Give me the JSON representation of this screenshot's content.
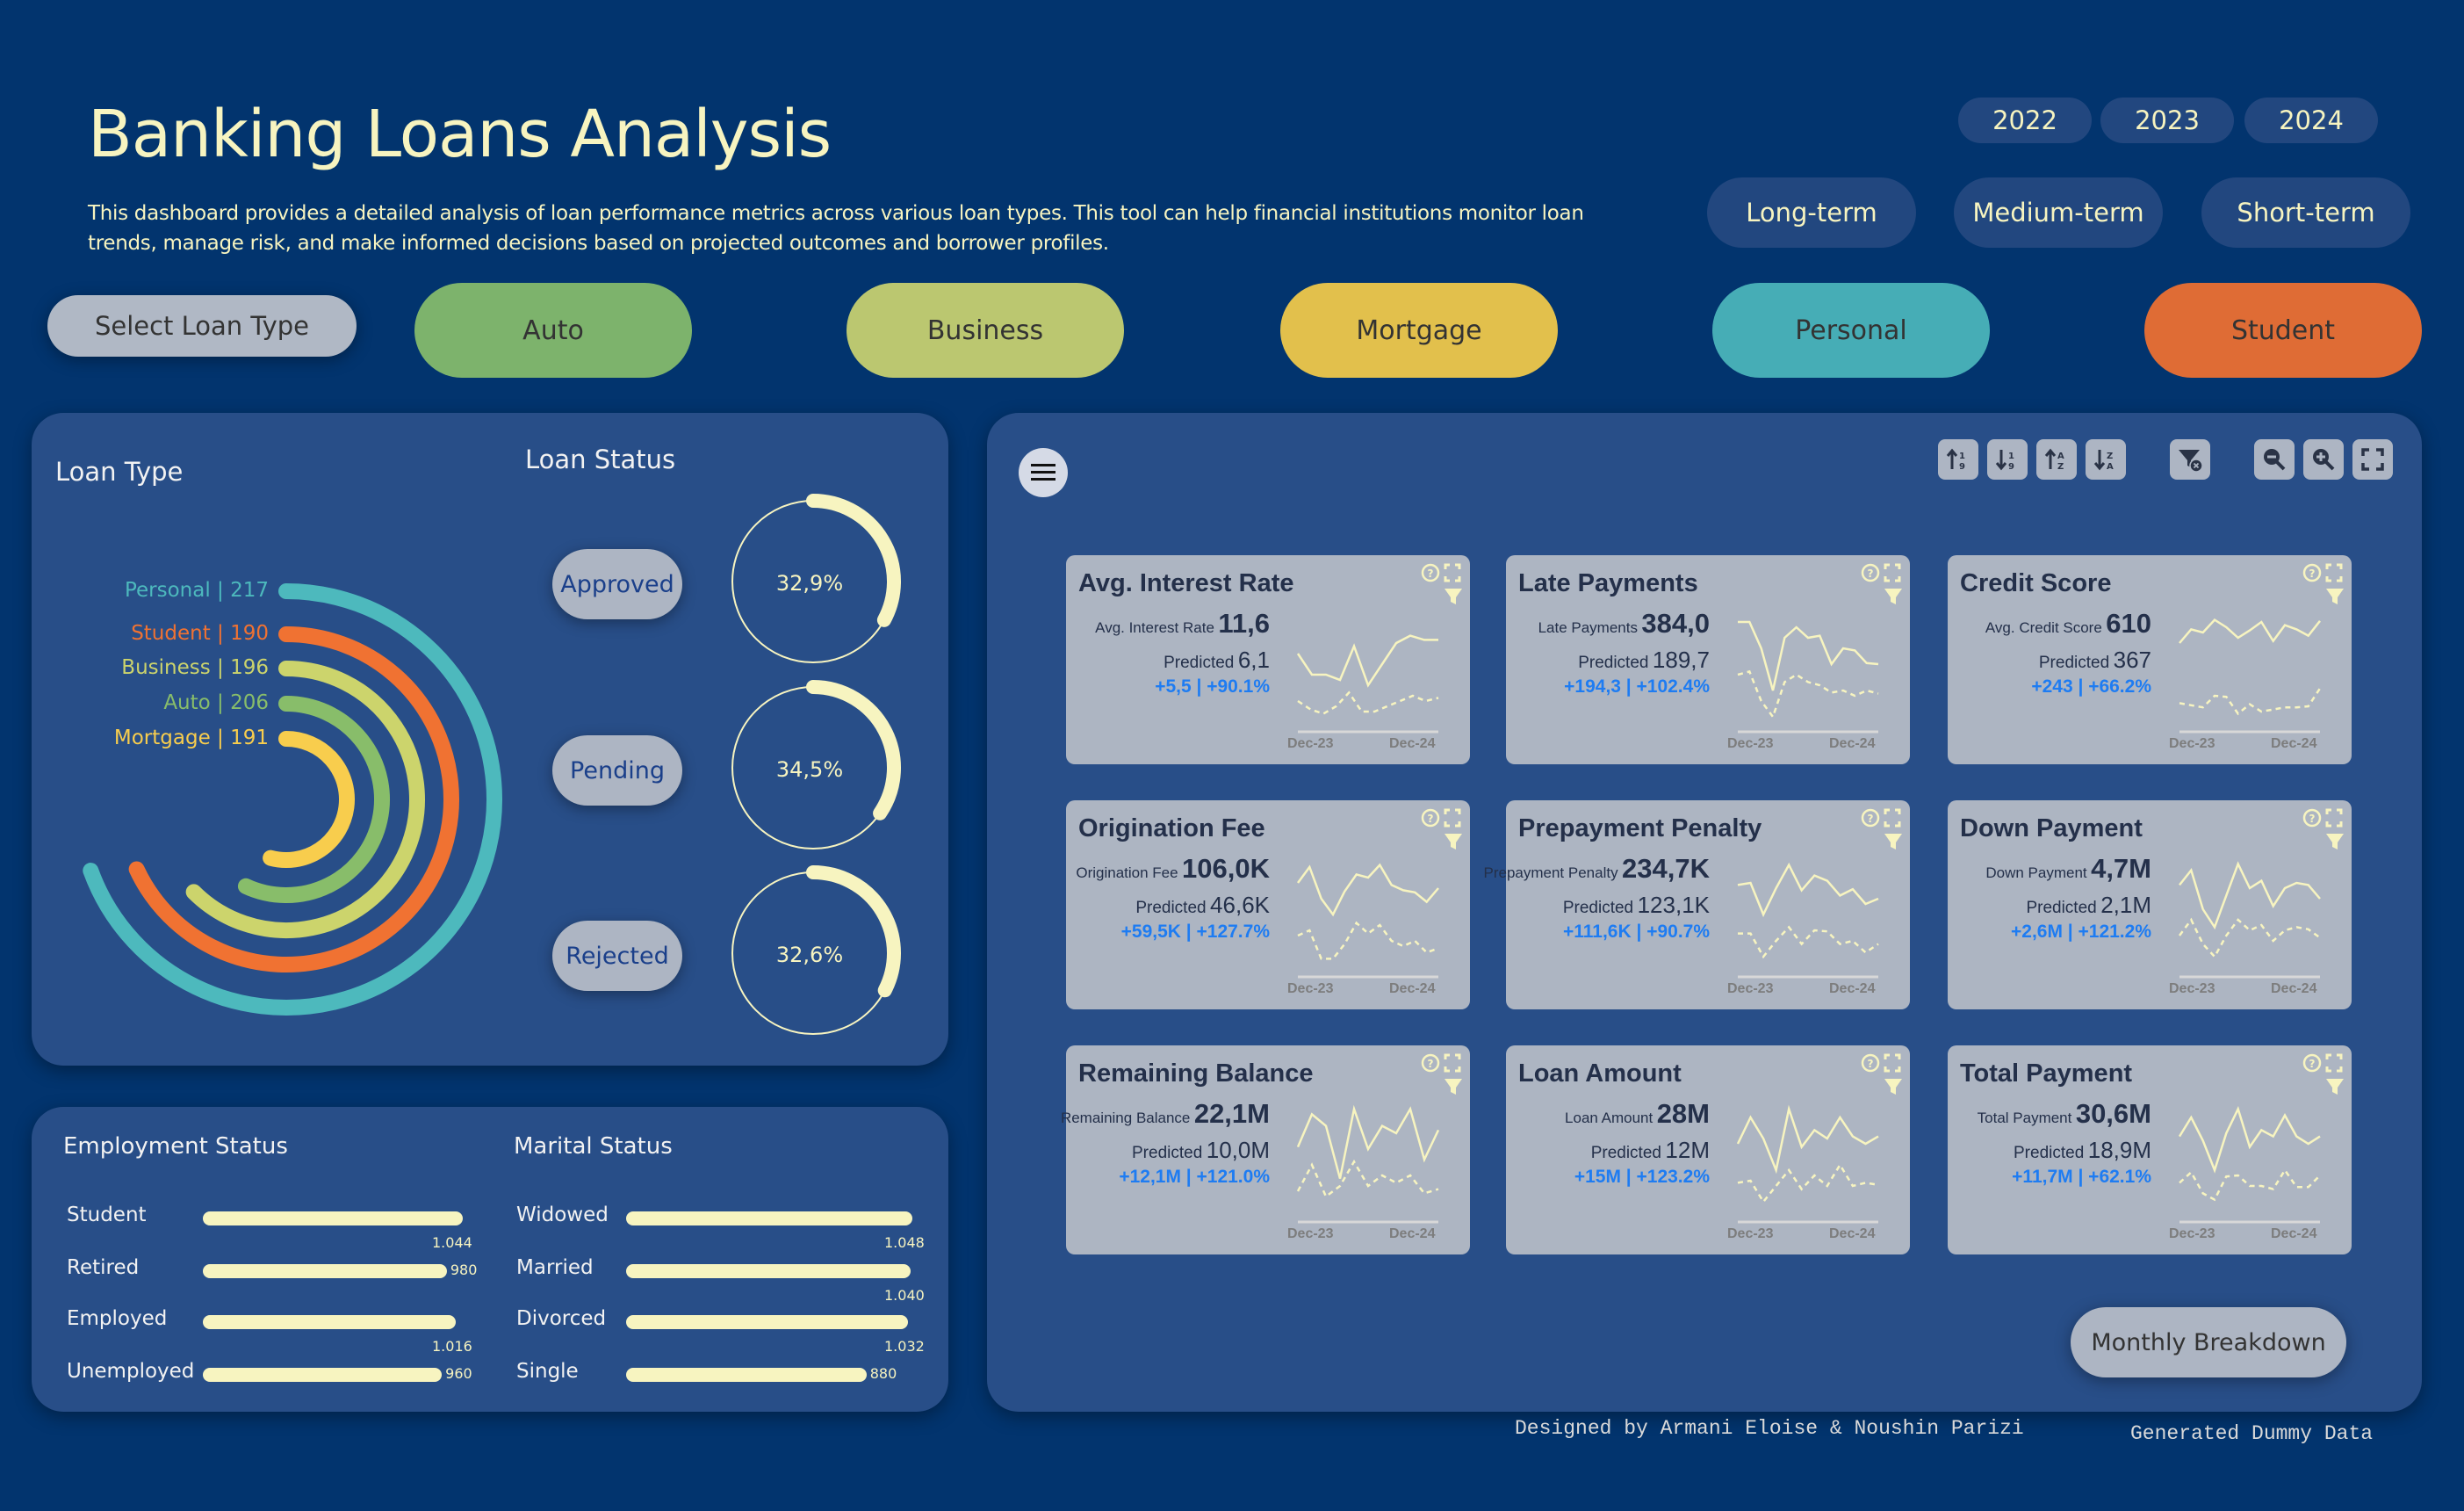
{
  "header": {
    "title": "Banking Loans Analysis",
    "description": "This dashboard provides a detailed analysis of loan performance metrics across various loan types. This tool can help financial institutions monitor loan trends, manage risk, and make informed decisions based on projected outcomes and borrower profiles."
  },
  "years": [
    "2022",
    "2023",
    "2024"
  ],
  "terms": [
    "Long-term",
    "Medium-term",
    "Short-term"
  ],
  "loan_type_filter": {
    "label": "Select Loan Type",
    "types": [
      {
        "label": "Auto",
        "color": "#7db36c"
      },
      {
        "label": "Business",
        "color": "#bbc770"
      },
      {
        "label": "Mortgage",
        "color": "#e2c04c"
      },
      {
        "label": "Personal",
        "color": "#46adb6"
      },
      {
        "label": "Student",
        "color": "#df6c35"
      }
    ]
  },
  "loan_type_panel": {
    "title": "Loan Type",
    "items": [
      {
        "label": "Personal",
        "count": "217",
        "text": "Personal | 217",
        "color": "#4db9bd"
      },
      {
        "label": "Student",
        "count": "190",
        "text": "Student | 190",
        "color": "#f07232"
      },
      {
        "label": "Business",
        "count": "196",
        "text": "Business | 196",
        "color": "#ccd46c"
      },
      {
        "label": "Auto",
        "count": "206",
        "text": "Auto | 206",
        "color": "#88bd6a"
      },
      {
        "label": "Mortgage",
        "count": "191",
        "text": "Mortgage | 191",
        "color": "#f8cd4d"
      }
    ]
  },
  "loan_status_panel": {
    "title": "Loan Status",
    "items": [
      {
        "label": "Approved",
        "percent_text": "32,9%",
        "percent": 32.9
      },
      {
        "label": "Pending",
        "percent_text": "34,5%",
        "percent": 34.5
      },
      {
        "label": "Rejected",
        "percent_text": "32,6%",
        "percent": 32.6
      }
    ]
  },
  "employment_status": {
    "title": "Employment Status",
    "items": [
      {
        "label": "Student",
        "value": 1044,
        "value_text": "1.044"
      },
      {
        "label": "Retired",
        "value": 980,
        "value_text": "980"
      },
      {
        "label": "Employed",
        "value": 1016,
        "value_text": "1.016"
      },
      {
        "label": "Unemployed",
        "value": 960,
        "value_text": "960"
      }
    ]
  },
  "marital_status": {
    "title": "Marital Status",
    "items": [
      {
        "label": "Widowed",
        "value": 1048,
        "value_text": "1.048"
      },
      {
        "label": "Married",
        "value": 1040,
        "value_text": "1.040"
      },
      {
        "label": "Divorced",
        "value": 1032,
        "value_text": "1.032"
      },
      {
        "label": "Single",
        "value": 880,
        "value_text": "880"
      }
    ]
  },
  "toolbar": {
    "menu": "menu-icon",
    "buttons": [
      "sort-ascending-numeric-icon",
      "sort-descending-numeric-icon",
      "sort-ascending-alpha-icon",
      "sort-descending-alpha-icon",
      "clear-filter-icon",
      "zoom-out-icon",
      "zoom-in-icon",
      "fullscreen-icon"
    ]
  },
  "kpi_cards": [
    {
      "title": "Avg. Interest Rate",
      "metric_label": "Avg. Interest Rate",
      "value": "11,6",
      "predicted_label": "Predicted",
      "predicted": "6,1",
      "delta": "+5,5 | +90.1%",
      "actual": [
        0.65,
        0.45,
        0.45,
        0.4,
        0.72,
        0.35,
        0.55,
        0.75,
        0.82,
        0.78,
        0.78
      ],
      "forecast": [
        0.2,
        0.12,
        0.08,
        0.15,
        0.28,
        0.1,
        0.1,
        0.15,
        0.2,
        0.25,
        0.2,
        0.23
      ]
    },
    {
      "title": "Late Payments",
      "metric_label": "Late Payments",
      "value": "384,0",
      "predicted_label": "Predicted",
      "predicted": "189,7",
      "delta": "+194,3 | +102.4%",
      "actual": [
        0.95,
        0.95,
        0.7,
        0.3,
        0.8,
        0.9,
        0.8,
        0.82,
        0.55,
        0.7,
        0.68,
        0.56,
        0.55
      ],
      "forecast": [
        0.45,
        0.48,
        0.2,
        0.05,
        0.38,
        0.45,
        0.38,
        0.35,
        0.28,
        0.3,
        0.25,
        0.3,
        0.27
      ]
    },
    {
      "title": "Credit Score",
      "metric_label": "Avg. Credit Score",
      "value": "610",
      "predicted_label": "Predicted",
      "predicted": "367",
      "delta": "+243 | +66.2%",
      "actual": [
        0.75,
        0.88,
        0.85,
        0.97,
        0.9,
        0.8,
        0.87,
        0.95,
        0.77,
        0.92,
        0.88,
        0.82,
        0.96
      ],
      "forecast": [
        0.18,
        0.16,
        0.14,
        0.25,
        0.24,
        0.08,
        0.17,
        0.1,
        0.12,
        0.14,
        0.14,
        0.15,
        0.32
      ]
    },
    {
      "title": "Origination Fee",
      "metric_label": "Origination Fee",
      "value": "106,0K",
      "predicted_label": "Predicted",
      "predicted": "46,6K",
      "delta": "+59,5K | +127.7%",
      "actual": [
        0.8,
        0.95,
        0.65,
        0.5,
        0.72,
        0.88,
        0.85,
        0.97,
        0.78,
        0.73,
        0.71,
        0.62,
        0.75
      ],
      "forecast": [
        0.3,
        0.35,
        0.08,
        0.08,
        0.22,
        0.42,
        0.32,
        0.4,
        0.25,
        0.2,
        0.25,
        0.14,
        0.18
      ]
    },
    {
      "title": "Prepayment Penalty",
      "metric_label": "Prepayment Penalty",
      "value": "234,7K",
      "predicted_label": "Predicted",
      "predicted": "123,1K",
      "delta": "+111,6K | +90.7%",
      "actual": [
        0.78,
        0.8,
        0.5,
        0.75,
        0.97,
        0.73,
        0.87,
        0.82,
        0.68,
        0.74,
        0.6,
        0.65
      ],
      "forecast": [
        0.32,
        0.32,
        0.1,
        0.25,
        0.38,
        0.22,
        0.35,
        0.34,
        0.22,
        0.25,
        0.14,
        0.22
      ]
    },
    {
      "title": "Down Payment",
      "metric_label": "Down Payment",
      "value": "4,7M",
      "predicted_label": "Predicted",
      "predicted": "2,1M",
      "delta": "+2,6M | +121.2%",
      "actual": [
        0.78,
        0.92,
        0.55,
        0.38,
        0.68,
        0.98,
        0.75,
        0.82,
        0.58,
        0.75,
        0.8,
        0.78,
        0.65
      ],
      "forecast": [
        0.3,
        0.45,
        0.22,
        0.1,
        0.3,
        0.45,
        0.35,
        0.4,
        0.25,
        0.35,
        0.38,
        0.36,
        0.28
      ]
    },
    {
      "title": "Remaining Balance",
      "metric_label": "Remaining Balance",
      "value": "22,1M",
      "predicted_label": "Predicted",
      "predicted": "10,0M",
      "delta": "+12,1M | +121.0%",
      "actual": [
        0.62,
        0.93,
        0.82,
        0.32,
        0.98,
        0.6,
        0.82,
        0.75,
        0.98,
        0.5,
        0.78
      ],
      "forecast": [
        0.2,
        0.45,
        0.15,
        0.25,
        0.48,
        0.25,
        0.35,
        0.28,
        0.35,
        0.18,
        0.22
      ]
    },
    {
      "title": "Loan Amount",
      "metric_label": "Loan Amount",
      "value": "28M",
      "predicted_label": "Predicted",
      "predicted": "12M",
      "delta": "+15M | +123.2%",
      "actual": [
        0.65,
        0.9,
        0.7,
        0.4,
        0.98,
        0.62,
        0.78,
        0.7,
        0.9,
        0.72,
        0.65,
        0.72
      ],
      "forecast": [
        0.28,
        0.3,
        0.1,
        0.25,
        0.4,
        0.22,
        0.35,
        0.25,
        0.45,
        0.25,
        0.28,
        0.26
      ]
    },
    {
      "title": "Total Payment",
      "metric_label": "Total Payment",
      "value": "30,6M",
      "predicted_label": "Predicted",
      "predicted": "18,9M",
      "delta": "+11,7M | +62.1%",
      "actual": [
        0.72,
        0.9,
        0.68,
        0.4,
        0.75,
        0.98,
        0.62,
        0.78,
        0.72,
        0.92,
        0.72,
        0.65,
        0.72
      ],
      "forecast": [
        0.28,
        0.38,
        0.18,
        0.12,
        0.34,
        0.35,
        0.25,
        0.25,
        0.22,
        0.4,
        0.24,
        0.24,
        0.35
      ]
    }
  ],
  "spark_ticks": [
    "Dec-23",
    "Dec-24"
  ],
  "monthly_button": "Monthly Breakdown",
  "footer": {
    "credit": "Designed by Armani Eloise & Noushin Parizi",
    "note": "Generated Dummy Data"
  }
}
